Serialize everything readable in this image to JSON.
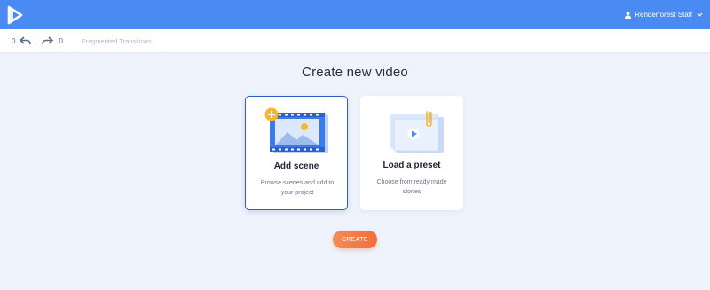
{
  "colors": {
    "topbar": "#4a8bf3",
    "page_bg": "#eef3fc",
    "selected_border": "#2f5fb8",
    "create_button": "#f2773f"
  },
  "header": {
    "user_name": "Renderforest Staff",
    "user_icon": "user-icon",
    "menu_icon": "chevron-down-icon"
  },
  "toolbar": {
    "undo_count": "0",
    "redo_count": "0",
    "project_name": "Fragmented Transitions ..."
  },
  "main": {
    "title": "Create new video",
    "cards": [
      {
        "title": "Add scene",
        "description": "Browse scenes and add to your project",
        "selected": true,
        "icon": "film-strip-add-icon"
      },
      {
        "title": "Load a preset",
        "description": "Choose from ready made stories",
        "selected": false,
        "icon": "preset-video-icon"
      }
    ],
    "create_label": "CREATE"
  }
}
